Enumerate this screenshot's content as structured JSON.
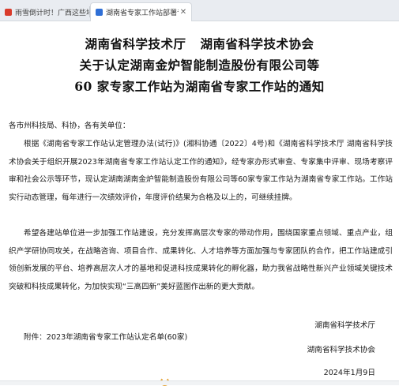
{
  "tabs": [
    {
      "title": "雨雪倒计时！广西这些地方将出现",
      "active": false
    },
    {
      "title": "湖南省专家工作站部署专题文件说明",
      "active": true
    }
  ],
  "heading": {
    "line1_part1": "湖南省科学技术厅",
    "line1_part2": "湖南省科学技术协会",
    "line2": "关于认定湖南金炉智能制造股份有限公司等",
    "line3": "60 家专家工作站为湖南省专家工作站的通知"
  },
  "body": {
    "salutation": "各市州科技局、科协，各有关单位：",
    "paragraph1": "根据《湖南省专家工作站认定管理办法(试行)》(湘科协通〔2022〕4号)和《湖南省科学技术厅 湖南省科学技术协会关于组织开展2023年湖南省专家工作站认定工作的通知》，经专家办形式审查、专家集中评审、现场考察评审和社会公示等环节，现认定湖南湖南金炉智能制造股份有限公司等60家专家工作站为湖南省专家工作站。工作站实行动态管理，每年进行一次绩效评价，年度评价结果为合格及以上的，可继续挂牌。",
    "paragraph2": "希望各建站单位进一步加强工作站建设，充分发挥高层次专家的带动作用，围绕国家重点领域、重点产业，组织产学研协同攻关，在战略咨询、项目合作、成果转化、人才培养等方面加强与专家团队的合作，把工作站建成引领创新发展的平台、培养高层次人才的基地和促进科技成果转化的孵化器，助力我省战略性新兴产业领域关键技术突破和科技成果转化，为加快实现“三高四新”美好蓝图作出新的更大贡献。",
    "attachment": "附件：2023年湖南省专家工作站认定名单(60家)"
  },
  "signature": {
    "org1": "湖南省科学技术厅",
    "org2": "湖南省科学技术协会",
    "date": "2024年1月9日"
  },
  "colors": {
    "tabbar_bg": "#e9ecf1",
    "favicon_news": "#d93b2b",
    "favicon_doc": "#2f6fd6",
    "loading": "#e5a436"
  },
  "icons": {
    "tab1_favicon": "news-site-icon",
    "tab2_favicon": "document-site-icon",
    "tab_close": "close-icon",
    "loading": "loading-spinner-icon"
  }
}
